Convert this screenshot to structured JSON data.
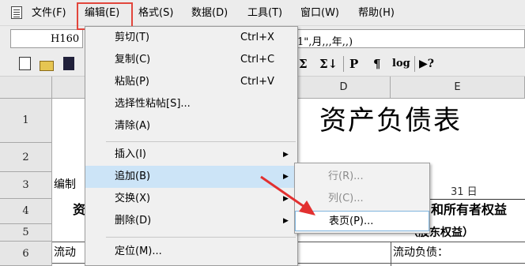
{
  "menubar": {
    "items": [
      {
        "label": "文件(F)"
      },
      {
        "label": "编辑(E)"
      },
      {
        "label": "格式(S)"
      },
      {
        "label": "数据(D)"
      },
      {
        "label": "工具(T)"
      },
      {
        "label": "窗口(W)"
      },
      {
        "label": "帮助(H)"
      }
    ]
  },
  "formula_bar": {
    "cell_ref": "H160",
    "formula": "1\",月,,,年,,)"
  },
  "toolbar": {
    "glyphs": [
      "Σ",
      "Σ↓",
      "P",
      "¶",
      "log",
      "▶?"
    ]
  },
  "sheet": {
    "columns": [
      {
        "label": ""
      },
      {
        "label": "D"
      },
      {
        "label": "E"
      }
    ],
    "rows": [
      {
        "label": "1"
      },
      {
        "label": "2"
      },
      {
        "label": "3"
      },
      {
        "label": "4"
      },
      {
        "label": "5"
      },
      {
        "label": "6"
      }
    ],
    "title": "资产负债表",
    "a3": "编制",
    "date_fragment": "31 日",
    "e4": "和所有者权益",
    "e5": "（股东权益）",
    "a4": "资",
    "a6": "流动",
    "e6": "流动负债："
  },
  "edit_menu": {
    "items": [
      {
        "label": "剪切(T)",
        "shortcut": "Ctrl+X"
      },
      {
        "label": "复制(C)",
        "shortcut": "Ctrl+C"
      },
      {
        "label": "粘贴(P)",
        "shortcut": "Ctrl+V"
      },
      {
        "label": "选择性粘帖[S]..."
      },
      {
        "label": "清除(A)"
      },
      {
        "label": "插入(I)",
        "submenu": true
      },
      {
        "label": "追加(B)",
        "submenu": true,
        "selected": true
      },
      {
        "label": "交换(X)",
        "submenu": true
      },
      {
        "label": "删除(D)",
        "submenu": true
      },
      {
        "label": "定位(M)..."
      }
    ]
  },
  "append_submenu": {
    "items": [
      {
        "label": "行(R)...",
        "disabled": true
      },
      {
        "label": "列(C)...",
        "disabled": true
      },
      {
        "label": "表页(P)...",
        "selected": true
      }
    ]
  },
  "colors": {
    "highlight_box": "#e2463c",
    "annotation_arrow": "#e23030",
    "menu_selection": "#cce4f7"
  }
}
